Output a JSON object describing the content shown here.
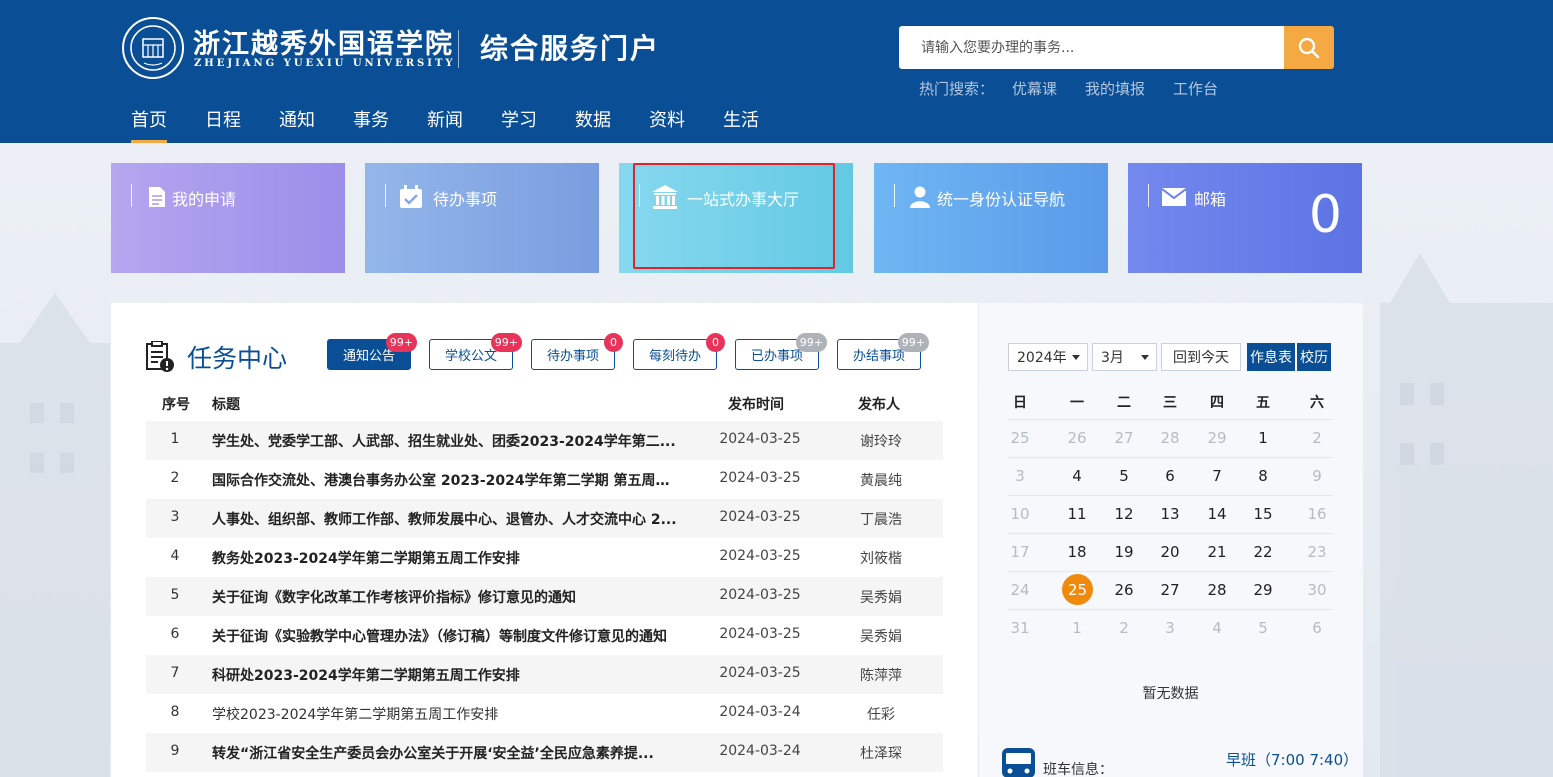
{
  "header": {
    "school_name_cn": "浙江越秀外国语学院",
    "school_name_en": "ZHEJIANG YUEXIU UNIVERSITY",
    "portal_title": "综合服务门户",
    "search_placeholder": "请输入您要办理的事务...",
    "hot_search_label": "热门搜索：",
    "hot_search_items": [
      "优幕课",
      "我的填报",
      "工作台"
    ]
  },
  "nav": [
    "首页",
    "日程",
    "通知",
    "事务",
    "新闻",
    "学习",
    "数据",
    "资料",
    "生活"
  ],
  "nav_active": "首页",
  "tiles": [
    {
      "label": "我的申请",
      "icon": "document-icon"
    },
    {
      "label": "待办事项",
      "icon": "calendar-check-icon"
    },
    {
      "label": "一站式办事大厅",
      "icon": "bank-icon"
    },
    {
      "label": "统一身份认证导航",
      "icon": "user-icon"
    },
    {
      "label": "邮箱",
      "icon": "mail-icon",
      "count": "0"
    }
  ],
  "task_center": {
    "title": "任务中心",
    "tabs": [
      {
        "label": "通知公告",
        "badge": "99+"
      },
      {
        "label": "学校公文",
        "badge": "99+"
      },
      {
        "label": "待办事项",
        "badge": "0"
      },
      {
        "label": "每刻待办",
        "badge": "0"
      },
      {
        "label": "已办事项",
        "badge": "99+"
      },
      {
        "label": "办结事项",
        "badge": "99+"
      }
    ],
    "columns": [
      "序号",
      "标题",
      "发布时间",
      "发布人"
    ],
    "rows": [
      {
        "no": "1",
        "title": "学生处、党委学工部、人武部、招生就业处、团委2023-2024学年第二...",
        "date": "2024-03-25",
        "publisher": "谢玲玲"
      },
      {
        "no": "2",
        "title": "国际合作交流处、港澳台事务办公室 2023-2024学年第二学期 第五周工...",
        "date": "2024-03-25",
        "publisher": "黄晨纯"
      },
      {
        "no": "3",
        "title": "人事处、组织部、教师工作部、教师发展中心、退管办、人才交流中心 2...",
        "date": "2024-03-25",
        "publisher": "丁晨浩"
      },
      {
        "no": "4",
        "title": "教务处2023-2024学年第二学期第五周工作安排",
        "date": "2024-03-25",
        "publisher": "刘筱楷"
      },
      {
        "no": "5",
        "title": "关于征询《数字化改革工作考核评价指标》修订意见的通知",
        "date": "2024-03-25",
        "publisher": "吴秀娟"
      },
      {
        "no": "6",
        "title": "关于征询《实验教学中心管理办法》（修订稿）等制度文件修订意见的通知",
        "date": "2024-03-25",
        "publisher": "吴秀娟"
      },
      {
        "no": "7",
        "title": "科研处2023-2024学年第二学期第五周工作安排",
        "date": "2024-03-25",
        "publisher": "陈萍萍"
      },
      {
        "no": "8",
        "title": "学校2023-2024学年第二学期第五周工作安排",
        "date": "2024-03-24",
        "publisher": "任彩"
      },
      {
        "no": "9",
        "title": "转发“浙江省安全生产委员会办公室关于开展‘安全益’全民应急素养提...",
        "date": "2024-03-24",
        "publisher": "杜泽琛"
      }
    ]
  },
  "calendar": {
    "year_select": "2024年",
    "month_select": "3月",
    "today_button": "回到今天",
    "schedule_button": "作息表",
    "school_calendar_button": "校历",
    "weekdays": [
      "日",
      "一",
      "二",
      "三",
      "四",
      "五",
      "六"
    ],
    "weeks": [
      [
        "25",
        "26",
        "27",
        "28",
        "29",
        "1",
        "2"
      ],
      [
        "3",
        "4",
        "5",
        "6",
        "7",
        "8",
        "9"
      ],
      [
        "10",
        "11",
        "12",
        "13",
        "14",
        "15",
        "16"
      ],
      [
        "17",
        "18",
        "19",
        "20",
        "21",
        "22",
        "23"
      ],
      [
        "24",
        "25",
        "26",
        "27",
        "28",
        "29",
        "30"
      ],
      [
        "31",
        "1",
        "2",
        "3",
        "4",
        "5",
        "6"
      ]
    ],
    "today": "25",
    "no_data": "暂无数据",
    "bus_label": "班车信息：",
    "bus_time": "早班（7:00 7:40）"
  },
  "colors": {
    "header_blue": "#0a4f96",
    "accent_orange": "#f4a942",
    "today_orange": "#f08a0c",
    "badge_red": "#e8335a",
    "highlight_red": "#e0242c"
  }
}
